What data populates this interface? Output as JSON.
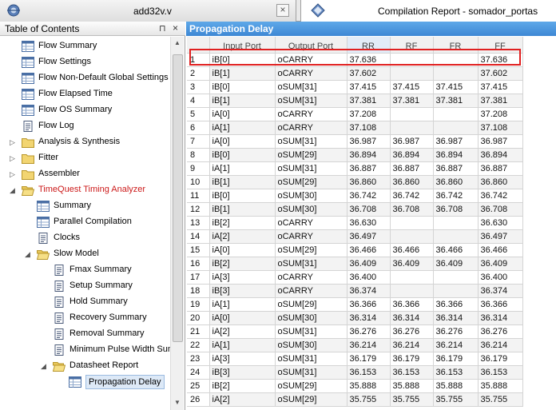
{
  "tabs": {
    "left_title": "add32v.v",
    "right_title": "Compilation Report - somador_portas",
    "close_symbol": "×"
  },
  "toc": {
    "title": "Table of Contents",
    "pin_symbol": "⊓",
    "close_symbol": "×",
    "items": [
      {
        "label": "Flow Summary",
        "icon": "table-icon",
        "indent": 1,
        "expander": ""
      },
      {
        "label": "Flow Settings",
        "icon": "table-icon",
        "indent": 1,
        "expander": ""
      },
      {
        "label": "Flow Non-Default Global Settings",
        "icon": "table-icon",
        "indent": 1,
        "expander": ""
      },
      {
        "label": "Flow Elapsed Time",
        "icon": "table-icon",
        "indent": 1,
        "expander": ""
      },
      {
        "label": "Flow OS Summary",
        "icon": "table-icon",
        "indent": 1,
        "expander": ""
      },
      {
        "label": "Flow Log",
        "icon": "document-icon",
        "indent": 1,
        "expander": ""
      },
      {
        "label": "Analysis & Synthesis",
        "icon": "folder-icon",
        "indent": 1,
        "expander": "▷"
      },
      {
        "label": "Fitter",
        "icon": "folder-icon",
        "indent": 1,
        "expander": "▷"
      },
      {
        "label": "Assembler",
        "icon": "folder-icon",
        "indent": 1,
        "expander": "▷"
      },
      {
        "label": "TimeQuest Timing Analyzer",
        "icon": "open-folder-icon",
        "indent": 1,
        "expander": "◢",
        "red": true
      },
      {
        "label": "Summary",
        "icon": "table-icon",
        "indent": 2,
        "expander": ""
      },
      {
        "label": "Parallel Compilation",
        "icon": "table-icon",
        "indent": 2,
        "expander": ""
      },
      {
        "label": "Clocks",
        "icon": "document-icon",
        "indent": 2,
        "expander": ""
      },
      {
        "label": "Slow Model",
        "icon": "open-folder-icon",
        "indent": 2,
        "expander": "◢"
      },
      {
        "label": "Fmax Summary",
        "icon": "document-icon",
        "indent": 3,
        "expander": ""
      },
      {
        "label": "Setup Summary",
        "icon": "document-icon",
        "indent": 3,
        "expander": ""
      },
      {
        "label": "Hold Summary",
        "icon": "document-icon",
        "indent": 3,
        "expander": ""
      },
      {
        "label": "Recovery Summary",
        "icon": "document-icon",
        "indent": 3,
        "expander": ""
      },
      {
        "label": "Removal Summary",
        "icon": "document-icon",
        "indent": 3,
        "expander": ""
      },
      {
        "label": "Minimum Pulse Width Summary",
        "icon": "document-icon",
        "indent": 3,
        "expander": ""
      },
      {
        "label": "Datasheet Report",
        "icon": "open-folder-icon",
        "indent": 3,
        "expander": "◢"
      },
      {
        "label": "Propagation Delay",
        "icon": "table-icon",
        "indent": 4,
        "expander": "",
        "selected": true
      }
    ]
  },
  "report": {
    "title": "Propagation Delay",
    "columns": [
      "",
      "Input Port",
      "Output Port",
      "RR",
      "RF",
      "FR",
      "FF"
    ],
    "rows": [
      [
        "1",
        "iB[0]",
        "oCARRY",
        "37.636",
        "",
        "",
        "37.636"
      ],
      [
        "2",
        "iB[1]",
        "oCARRY",
        "37.602",
        "",
        "",
        "37.602"
      ],
      [
        "3",
        "iB[0]",
        "oSUM[31]",
        "37.415",
        "37.415",
        "37.415",
        "37.415"
      ],
      [
        "4",
        "iB[1]",
        "oSUM[31]",
        "37.381",
        "37.381",
        "37.381",
        "37.381"
      ],
      [
        "5",
        "iA[0]",
        "oCARRY",
        "37.208",
        "",
        "",
        "37.208"
      ],
      [
        "6",
        "iA[1]",
        "oCARRY",
        "37.108",
        "",
        "",
        "37.108"
      ],
      [
        "7",
        "iA[0]",
        "oSUM[31]",
        "36.987",
        "36.987",
        "36.987",
        "36.987"
      ],
      [
        "8",
        "iB[0]",
        "oSUM[29]",
        "36.894",
        "36.894",
        "36.894",
        "36.894"
      ],
      [
        "9",
        "iA[1]",
        "oSUM[31]",
        "36.887",
        "36.887",
        "36.887",
        "36.887"
      ],
      [
        "10",
        "iB[1]",
        "oSUM[29]",
        "36.860",
        "36.860",
        "36.860",
        "36.860"
      ],
      [
        "11",
        "iB[0]",
        "oSUM[30]",
        "36.742",
        "36.742",
        "36.742",
        "36.742"
      ],
      [
        "12",
        "iB[1]",
        "oSUM[30]",
        "36.708",
        "36.708",
        "36.708",
        "36.708"
      ],
      [
        "13",
        "iB[2]",
        "oCARRY",
        "36.630",
        "",
        "",
        "36.630"
      ],
      [
        "14",
        "iA[2]",
        "oCARRY",
        "36.497",
        "",
        "",
        "36.497"
      ],
      [
        "15",
        "iA[0]",
        "oSUM[29]",
        "36.466",
        "36.466",
        "36.466",
        "36.466"
      ],
      [
        "16",
        "iB[2]",
        "oSUM[31]",
        "36.409",
        "36.409",
        "36.409",
        "36.409"
      ],
      [
        "17",
        "iA[3]",
        "oCARRY",
        "36.400",
        "",
        "",
        "36.400"
      ],
      [
        "18",
        "iB[3]",
        "oCARRY",
        "36.374",
        "",
        "",
        "36.374"
      ],
      [
        "19",
        "iA[1]",
        "oSUM[29]",
        "36.366",
        "36.366",
        "36.366",
        "36.366"
      ],
      [
        "20",
        "iA[0]",
        "oSUM[30]",
        "36.314",
        "36.314",
        "36.314",
        "36.314"
      ],
      [
        "21",
        "iA[2]",
        "oSUM[31]",
        "36.276",
        "36.276",
        "36.276",
        "36.276"
      ],
      [
        "22",
        "iA[1]",
        "oSUM[30]",
        "36.214",
        "36.214",
        "36.214",
        "36.214"
      ],
      [
        "23",
        "iA[3]",
        "oSUM[31]",
        "36.179",
        "36.179",
        "36.179",
        "36.179"
      ],
      [
        "24",
        "iB[3]",
        "oSUM[31]",
        "36.153",
        "36.153",
        "36.153",
        "36.153"
      ],
      [
        "25",
        "iB[2]",
        "oSUM[29]",
        "35.888",
        "35.888",
        "35.888",
        "35.888"
      ],
      [
        "26",
        "iA[2]",
        "oSUM[29]",
        "35.755",
        "35.755",
        "35.755",
        "35.755"
      ]
    ]
  },
  "colors": {
    "header_blue": "#3e88d4",
    "highlight_red": "#e02020",
    "tree_red_text": "#cc1a1a"
  }
}
